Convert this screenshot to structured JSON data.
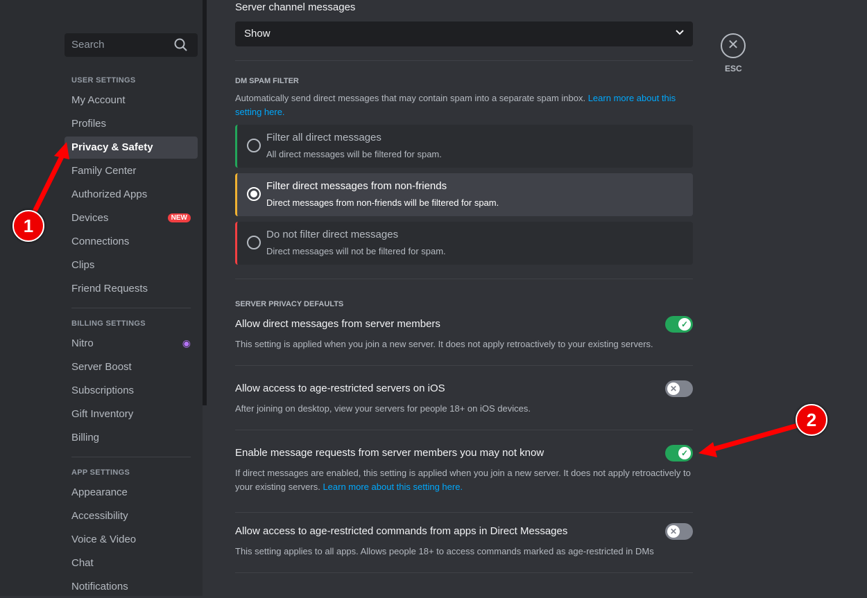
{
  "sidebar": {
    "search_placeholder": "Search",
    "user_header": "USER SETTINGS",
    "user_items": [
      "My Account",
      "Profiles",
      "Privacy & Safety",
      "Family Center",
      "Authorized Apps",
      "Devices",
      "Connections",
      "Clips",
      "Friend Requests"
    ],
    "selected": "Privacy & Safety",
    "new_badge": "NEW",
    "billing_header": "BILLING SETTINGS",
    "billing_items": [
      "Nitro",
      "Server Boost",
      "Subscriptions",
      "Gift Inventory",
      "Billing"
    ],
    "app_header": "APP SETTINGS",
    "app_items": [
      "Appearance",
      "Accessibility",
      "Voice & Video",
      "Chat",
      "Notifications"
    ]
  },
  "main": {
    "server_channel_label": "Server channel messages",
    "server_channel_value": "Show",
    "spam_header": "DM SPAM FILTER",
    "spam_desc": "Automatically send direct messages that may contain spam into a separate spam inbox. ",
    "spam_link": "Learn more about this setting here.",
    "spam_options": [
      {
        "title": "Filter all direct messages",
        "desc": "All direct messages will be filtered for spam.",
        "color": "#23a55a",
        "selected": false
      },
      {
        "title": "Filter direct messages from non-friends",
        "desc": "Direct messages from non-friends will be filtered for spam.",
        "color": "#f0b232",
        "selected": true
      },
      {
        "title": "Do not filter direct messages",
        "desc": "Direct messages will not be filtered for spam.",
        "color": "#f23f42",
        "selected": false
      }
    ],
    "privacy_header": "SERVER PRIVACY DEFAULTS",
    "settings": [
      {
        "title": "Allow direct messages from server members",
        "desc": "This setting is applied when you join a new server. It does not apply retroactively to your existing servers.",
        "on": true
      },
      {
        "title": "Allow access to age-restricted servers on iOS",
        "desc": "After joining on desktop, view your servers for people 18+ on iOS devices.",
        "on": false
      },
      {
        "title": "Enable message requests from server members you may not know",
        "desc": "If direct messages are enabled, this setting is applied when you join a new server. It does not apply retroactively to your existing servers. ",
        "link": "Learn more about this setting here.",
        "on": true
      },
      {
        "title": "Allow access to age-restricted commands from apps in Direct Messages",
        "desc": "This setting applies to all apps. Allows people 18+ to access commands marked as age-restricted in DMs",
        "on": false
      }
    ]
  },
  "esc_label": "ESC",
  "annotations": [
    "1",
    "2"
  ]
}
